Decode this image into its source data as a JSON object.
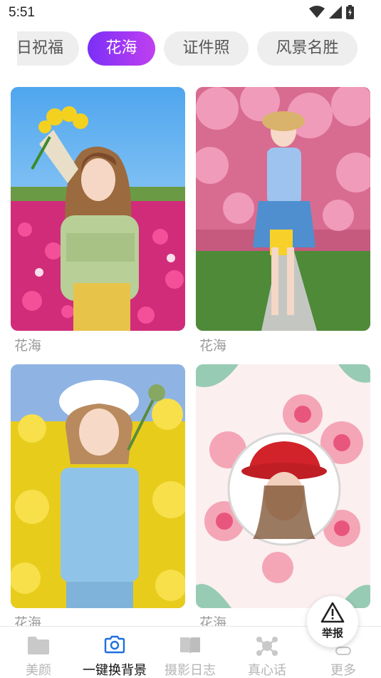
{
  "status_bar": {
    "time": "5:51",
    "icons": [
      "wifi-icon",
      "signal-icon",
      "battery-icon"
    ]
  },
  "tabs": [
    {
      "label": "日祝福",
      "active": false
    },
    {
      "label": "花海",
      "active": true
    },
    {
      "label": "证件照",
      "active": false
    },
    {
      "label": "风景名胜",
      "active": false
    }
  ],
  "cards": [
    {
      "caption": "花海",
      "scene": "girl holding flowers in pink flower field"
    },
    {
      "caption": "花海",
      "scene": "girl in blue under cherry blossom path"
    },
    {
      "caption": "花海",
      "scene": "girl in white hat in yellow rapeseed field"
    },
    {
      "caption": "花海",
      "scene": "portrait in floral paper-flower frame"
    }
  ],
  "report": {
    "label": "举报",
    "icon": "warning-icon"
  },
  "bottom_nav": [
    {
      "label": "美颜",
      "icon": "folder-icon",
      "active": false
    },
    {
      "label": "一键换背景",
      "icon": "camera-icon",
      "active": true
    },
    {
      "label": "摄影日志",
      "icon": "book-icon",
      "active": false
    },
    {
      "label": "真心话",
      "icon": "molecule-icon",
      "active": false
    },
    {
      "label": "更多",
      "icon": "more-icon",
      "active": false
    }
  ],
  "colors": {
    "active_tab_start": "#7b2ff7",
    "active_tab_end": "#c040f0",
    "caption": "#9a9a9a"
  }
}
